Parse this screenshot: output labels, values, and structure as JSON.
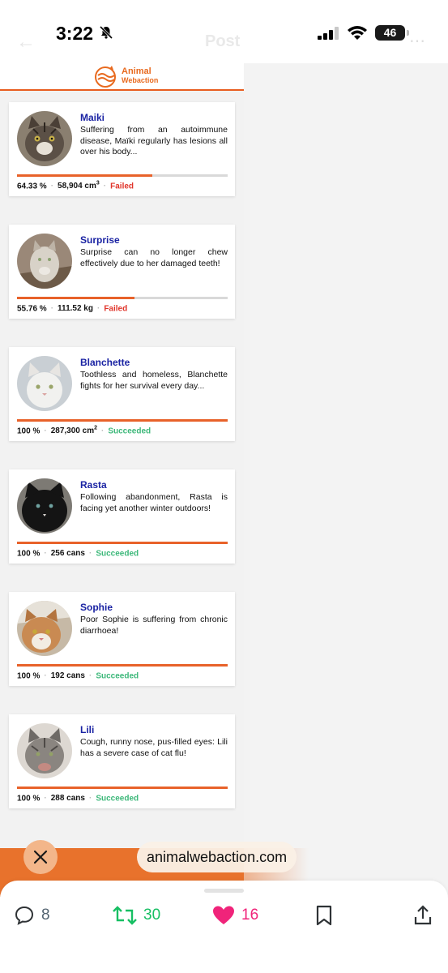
{
  "status_bar": {
    "time": "3:22",
    "battery": "46"
  },
  "header": {
    "ghost_title": "Post",
    "ghost_back": "←",
    "ghost_more": "⋯"
  },
  "site": {
    "logo_line1": "Animal",
    "logo_line2": "Webaction"
  },
  "cards": [
    {
      "name": "Maiki",
      "desc": "Suffering from an autoimmune disease, Maïki regularly has lesions all over his body...",
      "percent": "64.33 %",
      "amount": "58,904 cm",
      "unit_sup": "3",
      "status": "Failed",
      "progress": 0.6433
    },
    {
      "name": "Surprise",
      "desc": "Surprise can no longer chew effectively due to her damaged teeth!",
      "percent": "55.76 %",
      "amount": "111.52 kg",
      "unit_sup": "",
      "status": "Failed",
      "progress": 0.5576
    },
    {
      "name": "Blanchette",
      "desc": "Toothless and homeless, Blanchette fights for her survival every day...",
      "percent": "100 %",
      "amount": "287,300 cm",
      "unit_sup": "2",
      "status": "Succeeded",
      "progress": 1.0
    },
    {
      "name": "Rasta",
      "desc": "Following abandonment, Rasta is facing yet another winter outdoors!",
      "percent": "100 %",
      "amount": "256 cans",
      "unit_sup": "",
      "status": "Succeeded",
      "progress": 1.0
    },
    {
      "name": "Sophie",
      "desc": "Poor Sophie is suffering from chronic diarrhoea!",
      "percent": "100 %",
      "amount": "192 cans",
      "unit_sup": "",
      "status": "Succeeded",
      "progress": 1.0
    },
    {
      "name": "Lili",
      "desc": "Cough, runny nose, pus-filled eyes: Lili has a severe case of cat flu!",
      "percent": "100 %",
      "amount": "288 cans",
      "unit_sup": "",
      "status": "Succeeded",
      "progress": 1.0
    }
  ],
  "link": {
    "url": "animalwebaction.com"
  },
  "actions": {
    "replies": "8",
    "reposts": "30",
    "likes": "16"
  },
  "colors": {
    "accent": "#e8622a",
    "name_blue": "#1a23a3",
    "failed": "#e0342a",
    "succeeded": "#3db87a",
    "like": "#f0247a",
    "repost": "#17bf63"
  },
  "icons": [
    "bell-slash-icon",
    "cellular-signal-icon",
    "wifi-icon",
    "battery-icon",
    "close-icon",
    "reply-icon",
    "repost-icon",
    "heart-icon",
    "bookmark-icon",
    "share-icon"
  ]
}
